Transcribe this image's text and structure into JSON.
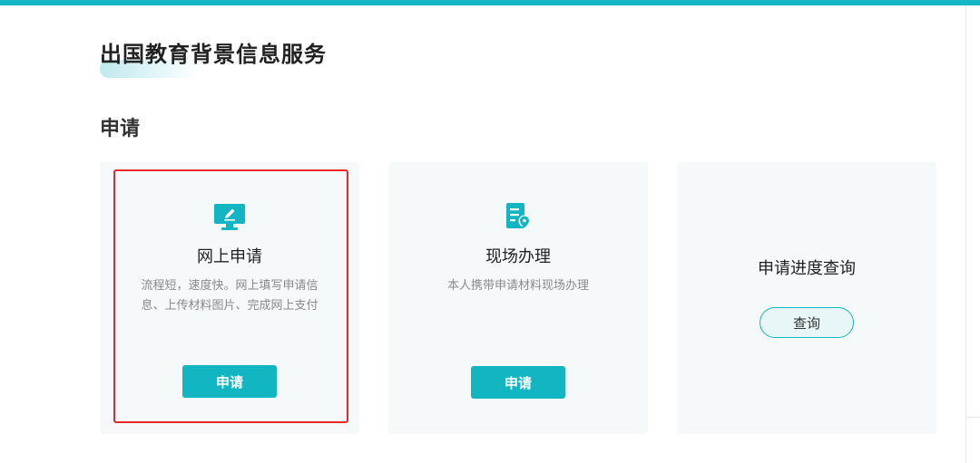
{
  "page": {
    "title": "出国教育背景信息服务",
    "section_title": "申请"
  },
  "cards": [
    {
      "icon": "monitor-edit-icon",
      "title": "网上申请",
      "desc_line1": "流程短，速度快。网上填写申请信",
      "desc_line2": "息、上传材料图片、完成网上支付",
      "button_label": "申请"
    },
    {
      "icon": "document-location-icon",
      "title": "现场办理",
      "desc_line1": "本人携带申请材料现场办理",
      "button_label": "申请"
    },
    {
      "title": "申请进度查询",
      "button_label": "查询"
    }
  ],
  "colors": {
    "accent": "#12b6c2",
    "top_bar": "#14b8c4",
    "highlight": "#e8262c",
    "card_bg": "#f5f9fa"
  }
}
